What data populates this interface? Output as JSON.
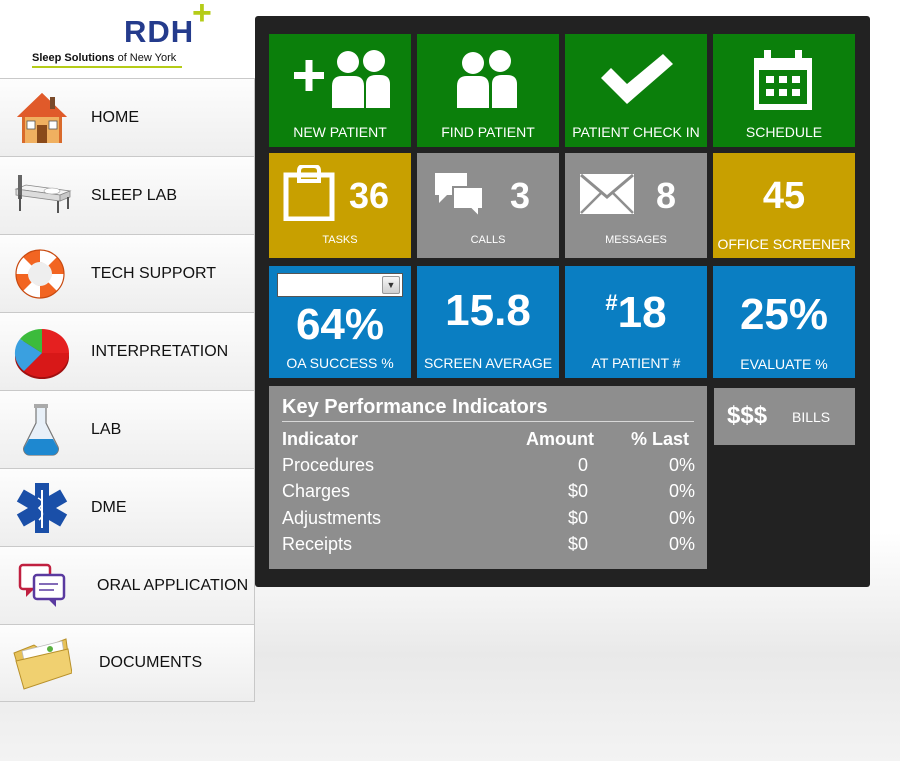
{
  "brand": {
    "name": "RDH",
    "plus": "+",
    "tagline": "Sleep Solutions",
    "tagline_suffix": "of New York",
    "accent": "#b5cc18",
    "color": "#243b8c"
  },
  "sidebar": {
    "items": [
      {
        "label": "HOME",
        "icon": "house-icon"
      },
      {
        "label": "SLEEP LAB",
        "icon": "bed-icon"
      },
      {
        "label": "TECH SUPPORT",
        "icon": "life-ring-icon"
      },
      {
        "label": "INTERPRETATION",
        "icon": "pie-chart-icon"
      },
      {
        "label": "LAB",
        "icon": "flask-icon"
      },
      {
        "label": "DME",
        "icon": "star-of-life-icon"
      },
      {
        "label": "ORAL APPLICATION",
        "icon": "chat-bubbles-icon"
      },
      {
        "label": "DOCUMENTS",
        "icon": "folder-icon"
      }
    ]
  },
  "tiles": {
    "new_patient": {
      "label": "NEW PATIENT",
      "icon": "add-user-icon",
      "color": "#0b7f0b"
    },
    "find_patient": {
      "label": "FIND PATIENT",
      "icon": "users-icon",
      "color": "#0b7f0b"
    },
    "check_in": {
      "label": "PATIENT CHECK IN",
      "icon": "checkmark-icon",
      "color": "#0b7f0b"
    },
    "schedule": {
      "label": "SCHEDULE",
      "icon": "calendar-icon",
      "color": "#0b7f0b"
    },
    "tasks": {
      "label": "TASKS",
      "count": "36",
      "icon": "clipboard-icon",
      "color": "#c8a000"
    },
    "calls": {
      "label": "CALLS",
      "count": "3",
      "icon": "speech-bubbles-icon",
      "color": "#8e8e8e"
    },
    "messages": {
      "label": "MESSAGES",
      "count": "8",
      "icon": "envelope-icon",
      "color": "#8e8e8e"
    },
    "office_screener": {
      "label": "OFFICE SCREENER",
      "count": "45",
      "color": "#c8a000"
    },
    "oa_success": {
      "label": "OA SUCCESS %",
      "value": "64%",
      "select_value": "",
      "color": "#0a7ec2"
    },
    "screen_average": {
      "label": "SCREEN AVERAGE",
      "value": "15.8",
      "color": "#0a7ec2"
    },
    "at_patient": {
      "label": "AT PATIENT #",
      "hash": "#",
      "value": "18",
      "color": "#0a7ec2"
    },
    "evaluate": {
      "label": "EVALUATE %",
      "value": "25%",
      "color": "#0a7ec2"
    },
    "bills": {
      "label": "BILLS",
      "symbol": "$$$",
      "color": "#8e8e8e"
    }
  },
  "kpi": {
    "title": "Key Performance Indicators",
    "columns": [
      "Indicator",
      "Amount",
      "% Last"
    ],
    "rows": [
      [
        "Procedures",
        "0",
        "0%"
      ],
      [
        "Charges",
        "$0",
        "0%"
      ],
      [
        "Adjustments",
        "$0",
        "0%"
      ],
      [
        "Receipts",
        "$0",
        "0%"
      ]
    ]
  }
}
